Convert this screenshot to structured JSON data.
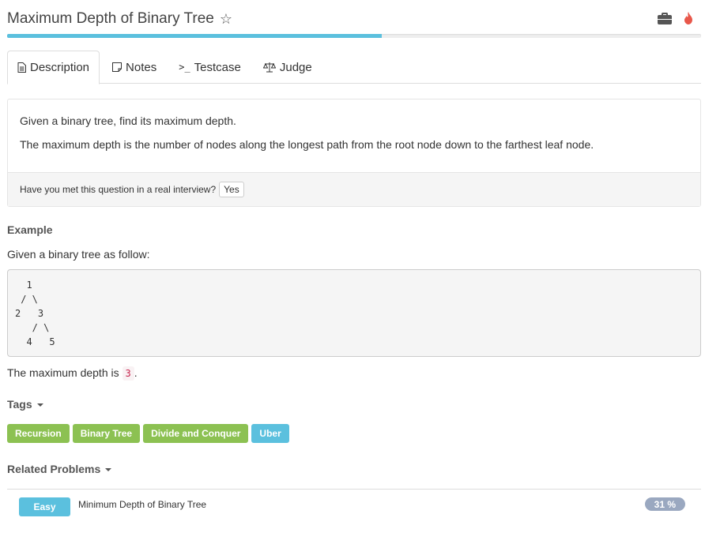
{
  "header": {
    "title": "Maximum Depth of Binary Tree",
    "star_icon": "star-outline-icon",
    "briefcase_icon": "briefcase-icon",
    "flame_icon": "flame-icon",
    "flame_color": "#e8574a"
  },
  "progress": {
    "percent": 54,
    "color": "#5bc0de"
  },
  "tabs": [
    {
      "label": "Description",
      "icon": "file-text-icon",
      "active": true
    },
    {
      "label": "Notes",
      "icon": "note-icon",
      "active": false
    },
    {
      "label": "Testcase",
      "icon": "terminal-icon",
      "active": false
    },
    {
      "label": "Judge",
      "icon": "balance-scale-icon",
      "active": false
    }
  ],
  "description": {
    "line1": "Given a binary tree, find its maximum depth.",
    "line2": "The maximum depth is the number of nodes along the longest path from the root node down to the farthest leaf node.",
    "interview_question": "Have you met this question in a real interview?",
    "yes_label": "Yes"
  },
  "example": {
    "heading": "Example",
    "intro": "Given a binary tree as follow:",
    "code": "  1\n / \\\n2   3\n   / \\\n  4   5",
    "result_prefix": "The maximum depth is ",
    "result_value": "3",
    "result_suffix": "."
  },
  "tags": {
    "heading": "Tags",
    "items": [
      {
        "label": "Recursion",
        "color": "#8cc152"
      },
      {
        "label": "Binary Tree",
        "color": "#8cc152"
      },
      {
        "label": "Divide and Conquer",
        "color": "#8cc152"
      },
      {
        "label": "Uber",
        "color": "#5bc0de"
      }
    ]
  },
  "related": {
    "heading": "Related Problems",
    "items": [
      {
        "difficulty": "Easy",
        "title": "Minimum Depth of Binary Tree",
        "percent": "31 %"
      }
    ]
  }
}
